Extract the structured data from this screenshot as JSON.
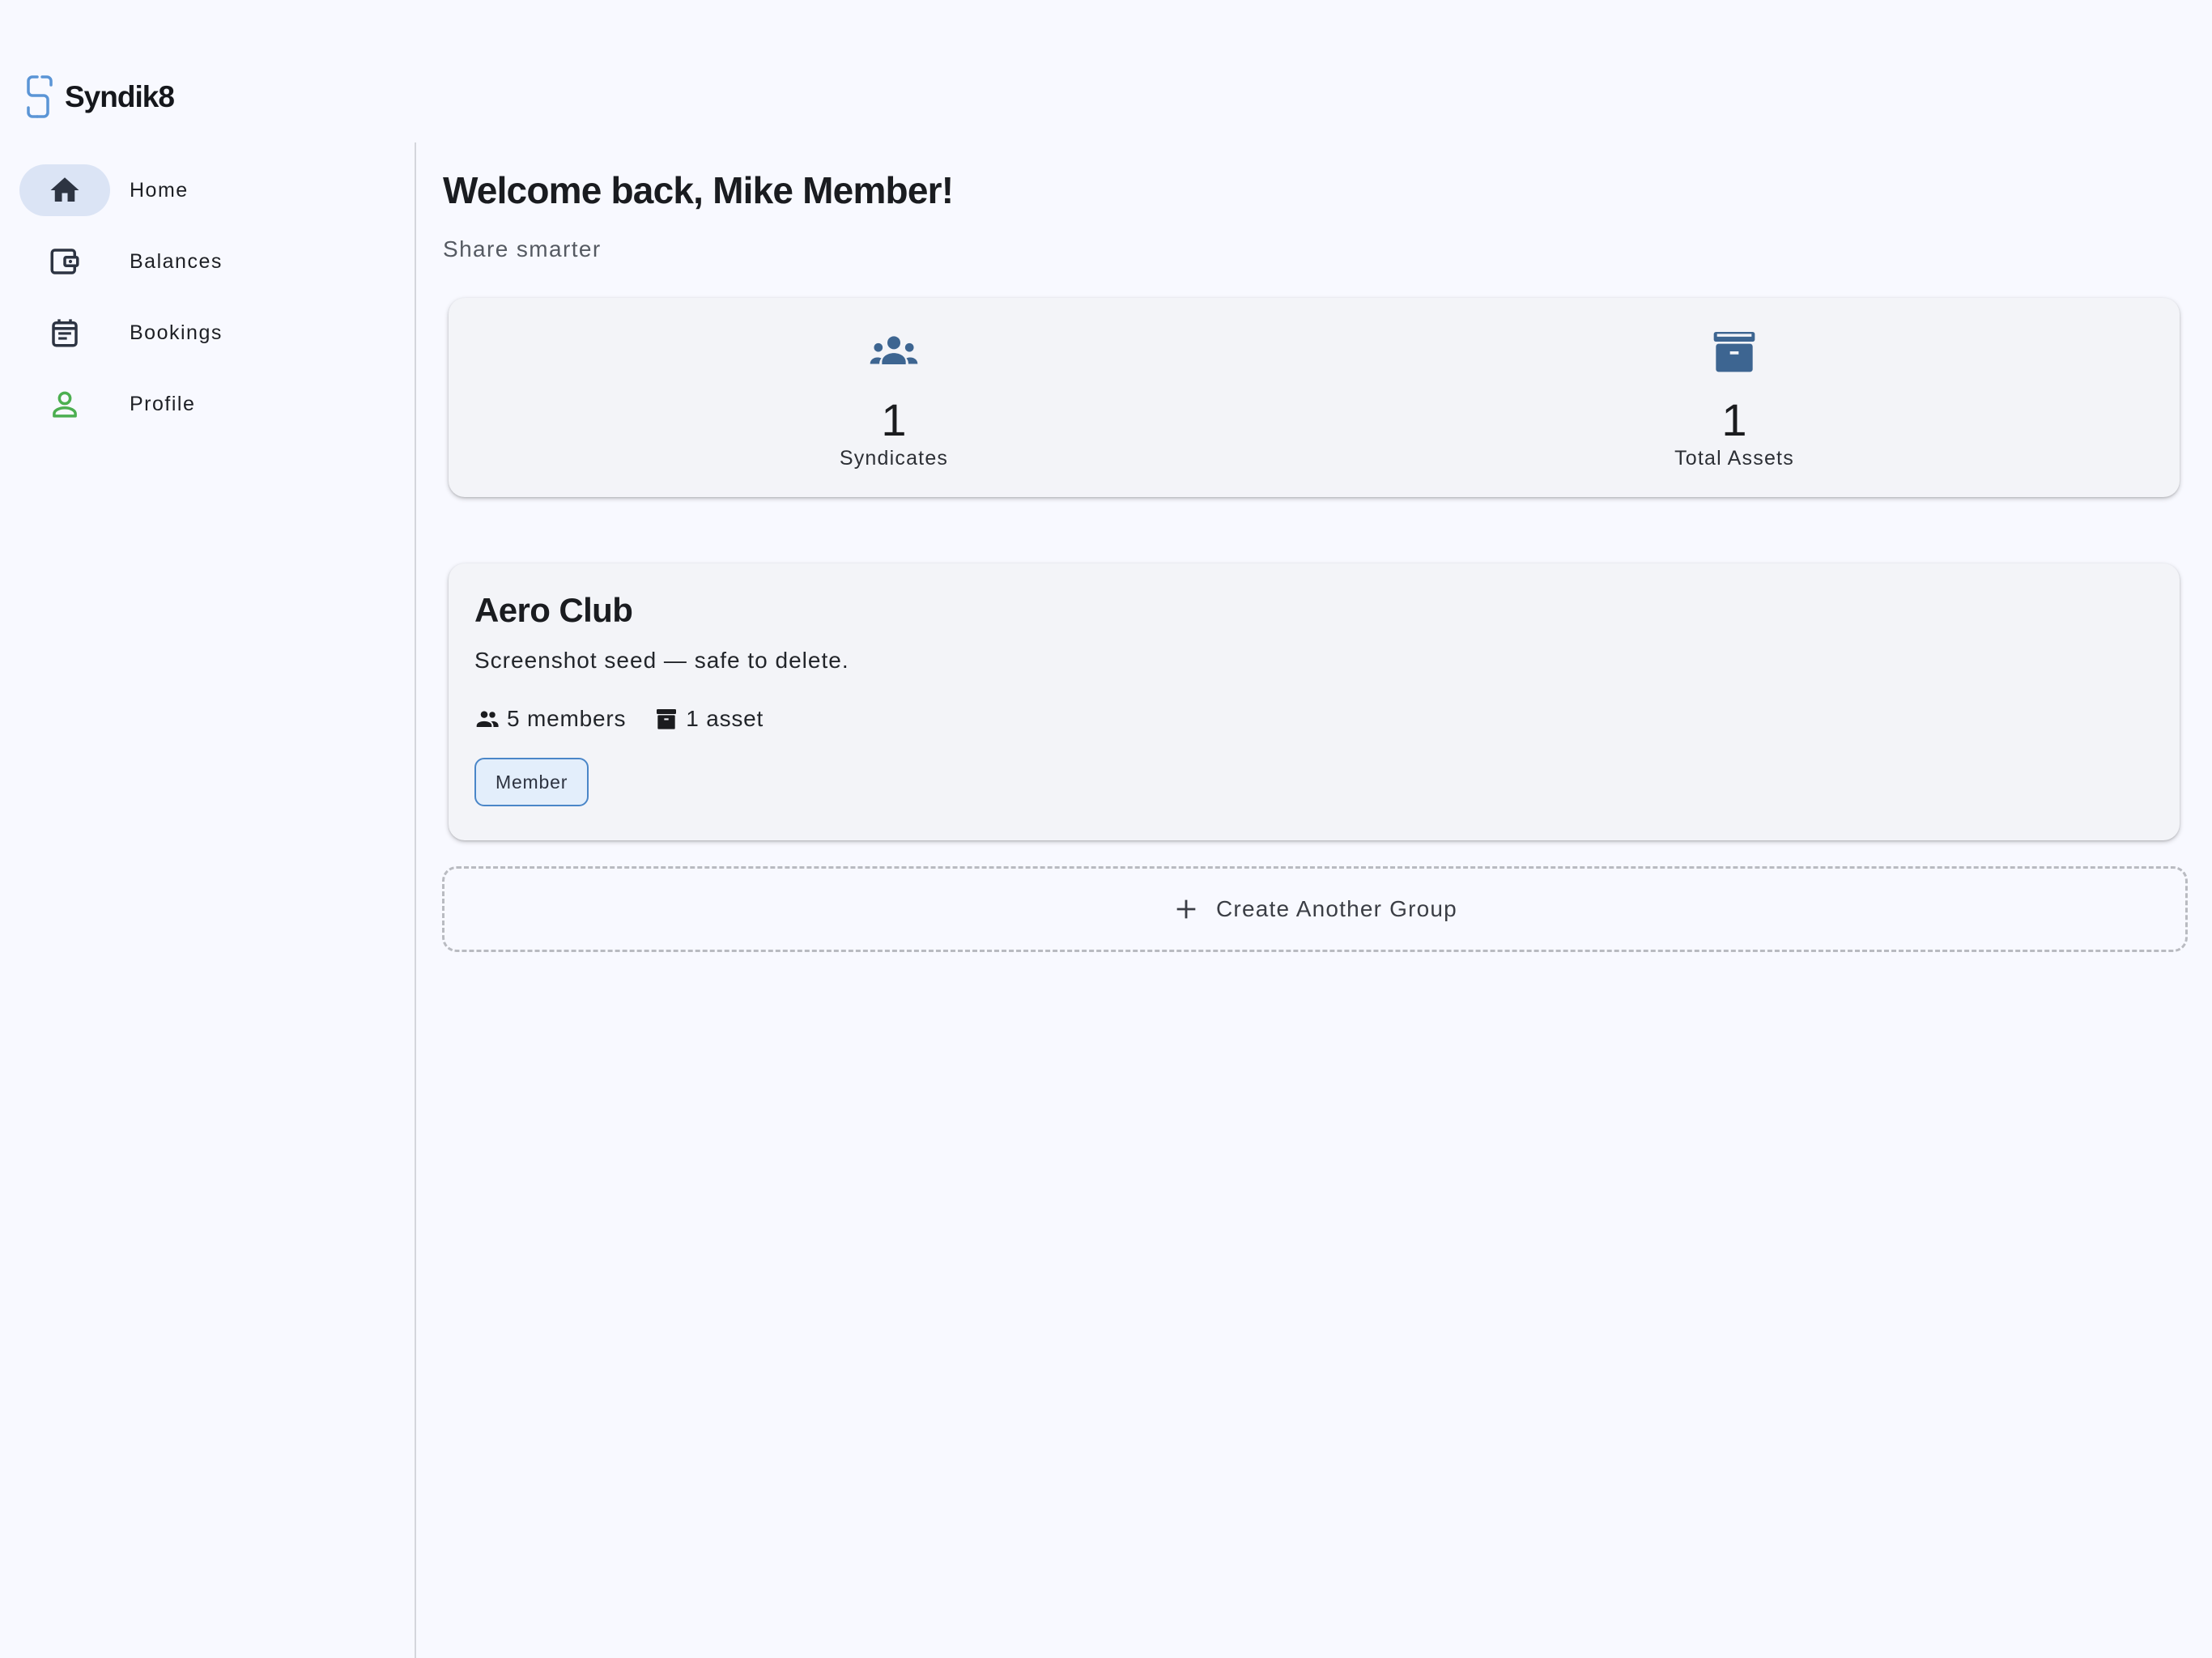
{
  "app": {
    "brand_name": "Syndik8"
  },
  "nav": {
    "items": [
      {
        "label": "Home",
        "icon": "home-icon",
        "active": true
      },
      {
        "label": "Balances",
        "icon": "wallet-icon",
        "active": false
      },
      {
        "label": "Bookings",
        "icon": "calendar-icon",
        "active": false
      },
      {
        "label": "Profile",
        "icon": "person-icon",
        "active": false
      }
    ]
  },
  "header": {
    "welcome": "Welcome back, Mike Member!",
    "tagline": "Share smarter"
  },
  "stats": [
    {
      "value": "1",
      "label": "Syndicates",
      "icon": "groups-icon"
    },
    {
      "value": "1",
      "label": "Total Assets",
      "icon": "archive-icon"
    }
  ],
  "groups": [
    {
      "name": "Aero Club",
      "description": "Screenshot seed — safe to delete.",
      "members": "5 members",
      "assets": "1 asset",
      "role": "Member"
    }
  ],
  "actions": {
    "create_group": "Create Another Group"
  },
  "colors": {
    "background": "#f8f9ff",
    "accent": "#3d6591",
    "active_pill": "#dbe4f5",
    "profile_icon": "#4caf50",
    "chip_border": "#4a86c8"
  }
}
